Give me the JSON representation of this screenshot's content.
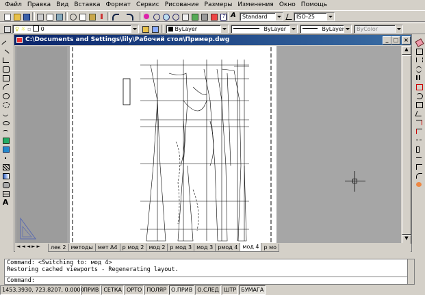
{
  "menu": [
    "Файл",
    "Правка",
    "Вид",
    "Вставка",
    "Формат",
    "Сервис",
    "Рисование",
    "Размеры",
    "Изменения",
    "Окно",
    "Помощь"
  ],
  "toolbar": {
    "text_style": "Standard",
    "dim_style": "ISO-25"
  },
  "layers": {
    "current_layer": "0",
    "color": "ByLayer",
    "linetype": "ByLayer",
    "lineweight": "ByLayer",
    "plot_style": "ByColor"
  },
  "document": {
    "title": "C:\\Documents and Settings\\lily\\Рабочий стол\\Пример.dwg"
  },
  "layout_tabs": [
    "лек 2",
    "методы",
    "мет А4",
    "р мод 2",
    "мод 2",
    "р мод 3",
    "мод 3",
    "рмод 4",
    "мод 4",
    "р мо"
  ],
  "active_tab": "мод 4",
  "command": {
    "line1": "Command:  <Switching to: мод 4>",
    "line2": "Restoring cached viewports - Regenerating layout.",
    "prompt": "Command:"
  },
  "status": {
    "coords": "1453.3930, 723.8207, 0.0000",
    "buttons": [
      "ПРИВ",
      "СЕТКА",
      "ОРТО",
      "ПОЛЯР",
      "О.ПРИВ",
      "О.СЛЕД",
      "ШТР",
      "БУМАГА"
    ],
    "active": [
      "О.ПРИВ",
      "БУМАГА"
    ]
  },
  "colors": {
    "title_start": "#0a246a",
    "title_end": "#3a6ea5",
    "canvas_gray": "#a6a6a6"
  }
}
